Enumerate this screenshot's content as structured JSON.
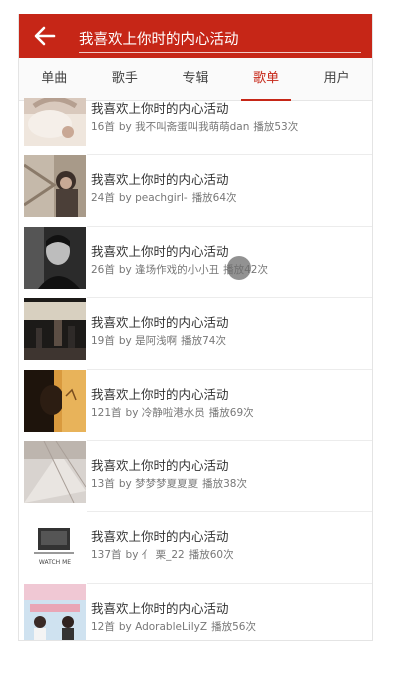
{
  "search": {
    "value": "我喜欢上你时的内心活动"
  },
  "tabs": [
    {
      "label": "单曲"
    },
    {
      "label": "歌手"
    },
    {
      "label": "专辑"
    },
    {
      "label": "歌单"
    },
    {
      "label": "用户"
    }
  ],
  "active_tab": "歌单",
  "playlists": [
    {
      "title": "我喜欢上你时的内心活动",
      "count": "16首",
      "creator": "by 我不叫斋蛋叫我萌萌dan",
      "plays": "播放53次"
    },
    {
      "title": "我喜欢上你时的内心活动",
      "count": "24首",
      "creator": "by peachgirl-",
      "plays": "播放64次"
    },
    {
      "title": "我喜欢上你时的内心活动",
      "count": "26首",
      "creator": "by 逢场作戏的小小丑",
      "plays": "播放42次"
    },
    {
      "title": "我喜欢上你时的内心活动",
      "count": "19首",
      "creator": "by 是阿浅啊",
      "plays": "播放74次"
    },
    {
      "title": "我喜欢上你时的内心活动",
      "count": "121首",
      "creator": "by 冷静啦港水员",
      "plays": "播放69次"
    },
    {
      "title": "我喜欢上你时的内心活动",
      "count": "13首",
      "creator": "by 梦梦梦夏夏夏",
      "plays": "播放38次"
    },
    {
      "title": "我喜欢上你时的内心活动",
      "count": "137首",
      "creator": "by 亻 栗_22",
      "plays": "播放60次"
    },
    {
      "title": "我喜欢上你时的内心活动",
      "count": "12首",
      "creator": "by AdorableLilyZ",
      "plays": "播放56次"
    }
  ],
  "thumb_text": {
    "watch_me": "WATCH ME"
  },
  "colors": {
    "accent": "#c62617",
    "text": "#333333",
    "subtext": "#777777"
  }
}
